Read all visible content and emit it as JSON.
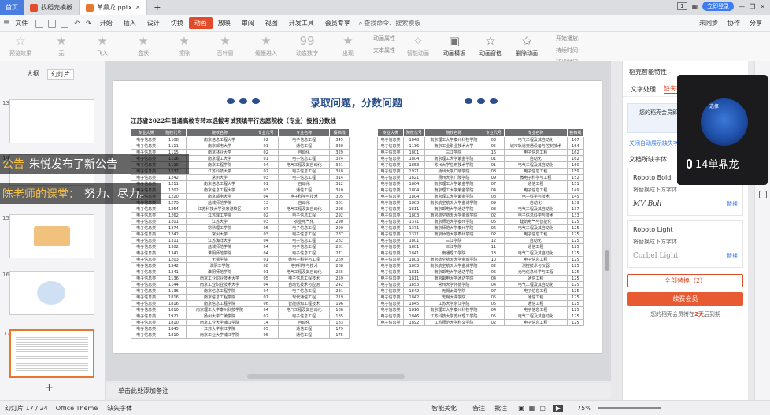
{
  "tabs": {
    "home": "首页",
    "tab1": "找稻壳模板",
    "tab2": "单鼎龙.pptx",
    "plus": "+",
    "login": "立即登录",
    "count": "1"
  },
  "menu": [
    "文件",
    "开始",
    "插入",
    "设计",
    "切换",
    "动画",
    "放映",
    "审阅",
    "视图",
    "开发工具",
    "会员专享"
  ],
  "menu_active": "动画",
  "search": {
    "placeholder": "查找命令、搜索模板"
  },
  "menu_right": {
    "sync": "未同步",
    "collab": "协作",
    "share": "分享"
  },
  "ribbon": {
    "preview": "预览效果",
    "items": [
      "无",
      "飞入",
      "盒状",
      "擦除",
      "百叶窗",
      "缓慢进入",
      "动态数字",
      "出现"
    ],
    "attrs": [
      "动画属性",
      "文本属性"
    ],
    "tools": [
      "智能动画",
      "动画模板",
      "动画窗格",
      "删除动画"
    ],
    "timing": {
      "start": "开始播放:",
      "duration": "持续时间:",
      "delay": "延迟时间:"
    }
  },
  "left_panel": {
    "tabs": [
      "大纲",
      "幻灯片"
    ],
    "slide_numbers": [
      "13",
      "14",
      "15",
      "16",
      "17"
    ],
    "add": "+"
  },
  "slide": {
    "title": "录取问题，分数问题",
    "subtitle": "江苏省2022年普通高校专转本选拔考试预填平行志愿院校（专业）投档分数线"
  },
  "table": {
    "headers": [
      "专业大类",
      "院校代号",
      "院校名称",
      "专业代号",
      "专业名称",
      "投档线"
    ],
    "left_rows": [
      [
        "电子信息类",
        "1108",
        "南京信息工程大学",
        "02",
        "电子信息工程",
        "345"
      ],
      [
        "电子信息类",
        "1111",
        "南京邮电大学",
        "01",
        "通信工程",
        "330"
      ],
      [
        "电子信息类",
        "1115",
        "南京林业大学",
        "02",
        "自动化",
        "329"
      ],
      [
        "电子信息类",
        "1116",
        "南京理工大学",
        "01",
        "电子信息工程",
        "324"
      ],
      [
        "电子信息类",
        "1120",
        "南京工程学院",
        "04",
        "电气工程及其自动化",
        "321"
      ],
      [
        "电子信息类",
        "1232",
        "江苏科技大学",
        "02",
        "电子信息工程",
        "318"
      ],
      [
        "电子信息类",
        "1242",
        "常州大学",
        "03",
        "电子信息工程",
        "314"
      ],
      [
        "电子信息类",
        "1211",
        "南京信息工程大学",
        "01",
        "自动化",
        "312"
      ],
      [
        "电子信息类",
        "1202",
        "南京信息工程大学",
        "03",
        "通信工程",
        "310"
      ],
      [
        "电子信息类",
        "1220",
        "南京邮电大学",
        "04",
        "电子科学与技术",
        "305"
      ],
      [
        "电子信息类",
        "1273",
        "盐城师范学院",
        "13",
        "自动化",
        "301"
      ],
      [
        "电子信息类",
        "1264",
        "江苏科技大学张家港校区",
        "07",
        "电气工程及其自动化",
        "298"
      ],
      [
        "电子信息类",
        "1262",
        "江苏理工学院",
        "02",
        "电子信息工程",
        "292"
      ],
      [
        "电子信息类",
        "1201",
        "江苏大学",
        "03",
        "农业电气化",
        "290"
      ],
      [
        "电子信息类",
        "1274",
        "常熟理工学院",
        "05",
        "电子信息工程",
        "290"
      ],
      [
        "电子信息类",
        "1242",
        "常州大学",
        "03",
        "电子信息工程",
        "287"
      ],
      [
        "电子信息类",
        "1311",
        "江苏海洋大学",
        "04",
        "电子信息工程",
        "282"
      ],
      [
        "电子信息类",
        "1302",
        "盐城师范学院",
        "04",
        "电子信息工程",
        "281"
      ],
      [
        "电子信息类",
        "1341",
        "淮阴师范学院",
        "04",
        "电子信息工程",
        "271"
      ],
      [
        "电子信息类",
        "1203",
        "无锡学院",
        "01",
        "微电子科学与工程",
        "269"
      ],
      [
        "电子信息类",
        "1342",
        "淮阴工学院",
        "08",
        "电子科学与技术",
        "268"
      ],
      [
        "电子信息类",
        "1341",
        "淮阴师范学院",
        "01",
        "电气工程及其自动化",
        "265"
      ],
      [
        "电子信息类",
        "1136",
        "南京工业职业技术大学",
        "05",
        "电子信息工程技术",
        "259"
      ],
      [
        "电子信息类",
        "1144",
        "南京工业职业技术大学",
        "04",
        "自动化技术与应用",
        "242"
      ],
      [
        "电子信息类",
        "1136",
        "南京信息工程学院",
        "04",
        "电子信息工程",
        "231"
      ],
      [
        "电子信息类",
        "1816",
        "南京信息工程学院",
        "07",
        "现代通信工程",
        "219"
      ],
      [
        "电子信息类",
        "1816",
        "南京信息工程学院",
        "06",
        "智能感知工程技术",
        "196"
      ],
      [
        "电子信息类",
        "1810",
        "南京理工大学泰州科技学院",
        "04",
        "电气工程及其自动化",
        "186"
      ],
      [
        "电子信息类",
        "1921",
        "扬州大学广陵学院",
        "02",
        "电子信息工程",
        "185"
      ],
      [
        "电子信息类",
        "1810",
        "南京工业大学浦江学院",
        "14",
        "自动化",
        "183"
      ],
      [
        "电子信息类",
        "1845",
        "江苏大学京江学院",
        "05",
        "通信工程",
        "179"
      ],
      [
        "电子信息类",
        "1810",
        "南京工业大学浦江学院",
        "05",
        "通信工程",
        "175"
      ]
    ],
    "right_rows": [
      [
        "电子信息类",
        "1848",
        "南京理工大学泰州科技学院",
        "03",
        "电气工程及其自动化",
        "167"
      ],
      [
        "电子信息类",
        "1136",
        "南京工业职业技术大学",
        "05",
        "城市轨道交通设备与控制技术",
        "164"
      ],
      [
        "电子信息类",
        "1801",
        "三江学院",
        "16",
        "电子信息工程",
        "162"
      ],
      [
        "电子信息类",
        "1804",
        "南京理工大学紫金学院",
        "01",
        "自动化",
        "162"
      ],
      [
        "电子信息类",
        "1853",
        "苏州大学应用技术学院",
        "01",
        "电气工程及其自动化",
        "160"
      ],
      [
        "电子信息类",
        "1921",
        "扬州大学广陵学院",
        "08",
        "电子信息工程",
        "159"
      ],
      [
        "电子信息类",
        "1821",
        "扬州大学广陵学院",
        "09",
        "微电子科学与工程",
        "152"
      ],
      [
        "电子信息类",
        "1804",
        "南京理工大学紫金学院",
        "07",
        "通信工程",
        "151"
      ],
      [
        "电子信息类",
        "1804",
        "南京理工大学紫金学院",
        "04",
        "电子信息工程",
        "149"
      ],
      [
        "电子信息类",
        "1804",
        "南京理工大学紫金学院",
        "08",
        "电子科学与技术",
        "145"
      ],
      [
        "电子信息类",
        "1803",
        "南京航空航天大学金城学院",
        "09",
        "自动化",
        "139"
      ],
      [
        "电子信息类",
        "1811",
        "南京邮电大学通达学院",
        "03",
        "电气工程及其自动化",
        "137"
      ],
      [
        "电子信息类",
        "1803",
        "南京航空航天大学金城学院",
        "02",
        "电子信息科学与技术",
        "133"
      ],
      [
        "电子信息类",
        "1371",
        "南京师范大学泰州学院",
        "05",
        "建筑电气与智能化",
        "125"
      ],
      [
        "电子信息类",
        "1371",
        "南京师范大学泰州学院",
        "06",
        "电气工程及其自动化",
        "125"
      ],
      [
        "电子信息类",
        "1371",
        "南京师范大学泰州学院",
        "02",
        "电子信息工程",
        "125"
      ],
      [
        "电子信息类",
        "1801",
        "三江学院",
        "12",
        "自动化",
        "125"
      ],
      [
        "电子信息类",
        "1801",
        "三江学院",
        "11",
        "通信工程",
        "125"
      ],
      [
        "电子信息类",
        "1841",
        "南通理工学院",
        "13",
        "电气工程及其自动化",
        "125"
      ],
      [
        "电子信息类",
        "1803",
        "南京航空航天大学金城学院",
        "10",
        "电子信息工程",
        "125"
      ],
      [
        "电子信息类",
        "1803",
        "南京航空航天大学金城学院",
        "02",
        "测控技术与仪器",
        "125"
      ],
      [
        "电子信息类",
        "1811",
        "南京邮电大学通达学院",
        "06",
        "光电信息科学与工程",
        "125"
      ],
      [
        "电子信息类",
        "1811",
        "南京邮电大学通达学院",
        "04",
        "通信工程",
        "125"
      ],
      [
        "电子信息类",
        "1853",
        "常州大学怀德学院",
        "04",
        "电气工程及其自动化",
        "125"
      ],
      [
        "电子信息类",
        "1842",
        "无锡太湖学院",
        "07",
        "电子信息工程",
        "125"
      ],
      [
        "电子信息类",
        "1842",
        "无锡太湖学院",
        "05",
        "通信工程",
        "125"
      ],
      [
        "电子信息类",
        "1845",
        "江苏大学京江学院",
        "05",
        "通信工程",
        "125"
      ],
      [
        "电子信息类",
        "1810",
        "南京理工大学泰州科技学院",
        "04",
        "电子信息工程",
        "125"
      ],
      [
        "电子信息类",
        "1846",
        "江苏科技大学苏州理工学院",
        "05",
        "电气工程及其自动化",
        "125"
      ],
      [
        "电子信息类",
        "1892",
        "江苏师范大学科文学院",
        "02",
        "电子信息工程",
        "125"
      ]
    ]
  },
  "notes_placeholder": "单击此处添加备注",
  "right_panel": {
    "header": "稻壳智能特性 -",
    "tabs": [
      "文字处理",
      "缺失字体"
    ],
    "notice": "您的稻壳会员即将到期，立即续费",
    "link": "关闭自动展示缺失字体",
    "section": "文档所缺字体",
    "fonts": [
      {
        "name": "Roboto Bold",
        "hint": "将替换成下方字体",
        "sample": "MV Boli",
        "action": "替换"
      },
      {
        "name": "Roboto Light",
        "hint": "将替换成下方字体",
        "sample": "Corbel Light",
        "action": "替换"
      }
    ],
    "replace_all": "全部替换（2）",
    "renew": "续费会员",
    "expire_prefix": "您的稻壳会员将在",
    "expire_days": "2天",
    "expire_suffix": "后到期"
  },
  "overlays": {
    "line1_name": "公告",
    "line1_text": "朱悦发布了新公告",
    "line2_name": "陈老师的课堂：",
    "line2_text": "努力、尽力。"
  },
  "video": {
    "name": "14单鼎龙",
    "logo": "选择"
  },
  "statusbar": {
    "slide": "幻灯片 17 / 24",
    "theme": "Office Theme",
    "missing": "缺失字体",
    "beautify": "智能美化",
    "notes": "备注",
    "comments": "批注",
    "zoom": "75%"
  },
  "colors": {
    "accent": "#e14b2a",
    "blue": "#3d7bf0",
    "table_header": "#6c6e72",
    "title_blue": "#2b4f8a"
  }
}
